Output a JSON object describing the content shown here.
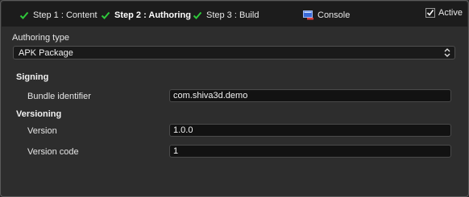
{
  "toolbar": {
    "step1_label": "Step 1 : Content",
    "step2_label": "Step 2 : Authoring",
    "step3_label": "Step 3 : Build",
    "console_label": "Console",
    "active_label": "Active",
    "active_checked": true
  },
  "authoring": {
    "type_label": "Authoring type",
    "type_value": "APK Package"
  },
  "signing": {
    "title": "Signing",
    "bundle_label": "Bundle identifier",
    "bundle_value": "com.shiva3d.demo"
  },
  "versioning": {
    "title": "Versioning",
    "version_label": "Version",
    "version_value": "1.0.0",
    "code_label": "Version code",
    "code_value": "1"
  },
  "colors": {
    "check_green": "#2ec83a",
    "background": "#2d2d2d",
    "toolbar_bg": "#1c1c1c"
  },
  "icons": {
    "step_done": "checkmark-icon",
    "console": "console-icon",
    "dropdown": "updown-arrows-icon"
  }
}
